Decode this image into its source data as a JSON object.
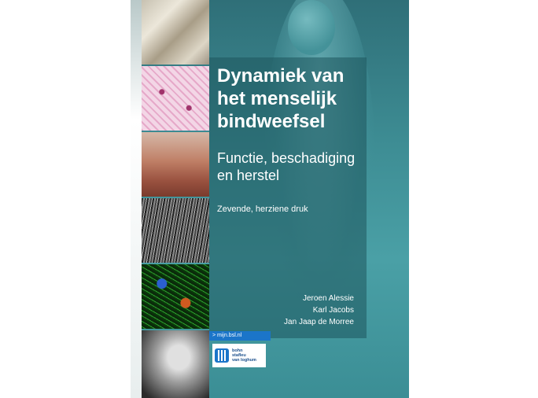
{
  "cover": {
    "title": "Dynamiek van het menselijk bindweefsel",
    "subtitle": "Functie, beschadiging en herstel",
    "edition": "Zevende, herziene druk",
    "authors": [
      "Jeroen Alessie",
      "Karl Jacobs",
      "Jan Jaap de Morree"
    ],
    "badge": "> mijn.bsl.nl",
    "publisher_lines": [
      "bohn",
      "stafleu",
      "van loghum"
    ]
  },
  "colors": {
    "cover_teal": "#3d8c93",
    "badge_blue": "#1b75c9"
  }
}
